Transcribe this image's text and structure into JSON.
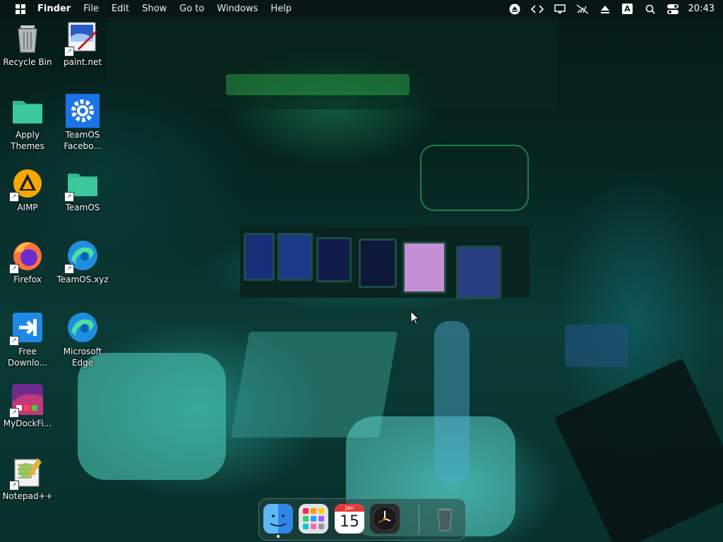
{
  "menubar": {
    "app_name": "Finder",
    "items": [
      "File",
      "Edit",
      "Show",
      "Go to",
      "Windows",
      "Help"
    ],
    "status_icons": [
      "eject-icon",
      "code-icon",
      "monitor-icon",
      "mute-icon",
      "upload-icon",
      "input-method-icon",
      "search-icon",
      "control-center-icon"
    ],
    "input_method": "A",
    "clock": "20:43"
  },
  "desktop_icons": [
    {
      "name": "Recycle Bin",
      "icon": "recycle-bin-icon"
    },
    {
      "name": "paint.net",
      "icon": "paintnet-icon"
    },
    {
      "name": "Apply Themes",
      "icon": "folder-icon"
    },
    {
      "name": "TeamOS Facebo...",
      "icon": "gear-icon"
    },
    {
      "name": "AIMP",
      "icon": "aimp-icon"
    },
    {
      "name": "TeamOS",
      "icon": "folder-icon"
    },
    {
      "name": "Firefox",
      "icon": "firefox-icon"
    },
    {
      "name": "TeamOS.xyz",
      "icon": "edge-icon"
    },
    {
      "name": "Free Downlo...",
      "icon": "download-icon"
    },
    {
      "name": "Microsoft Edge",
      "icon": "edge-icon"
    },
    {
      "name": "MyDockFi...",
      "icon": "mydock-icon"
    },
    {
      "name": "Notepad++",
      "icon": "notepadpp-icon"
    }
  ],
  "dock": {
    "apps": [
      "finder-icon",
      "launchpad-icon",
      "calendar-icon",
      "clock-icon",
      "trash-icon"
    ],
    "calendar": {
      "month": "Jan",
      "day": "15"
    }
  },
  "colors": {
    "menubar": "#0a1614",
    "accent": "#2bd4b6",
    "folder": "#3cc79c"
  }
}
